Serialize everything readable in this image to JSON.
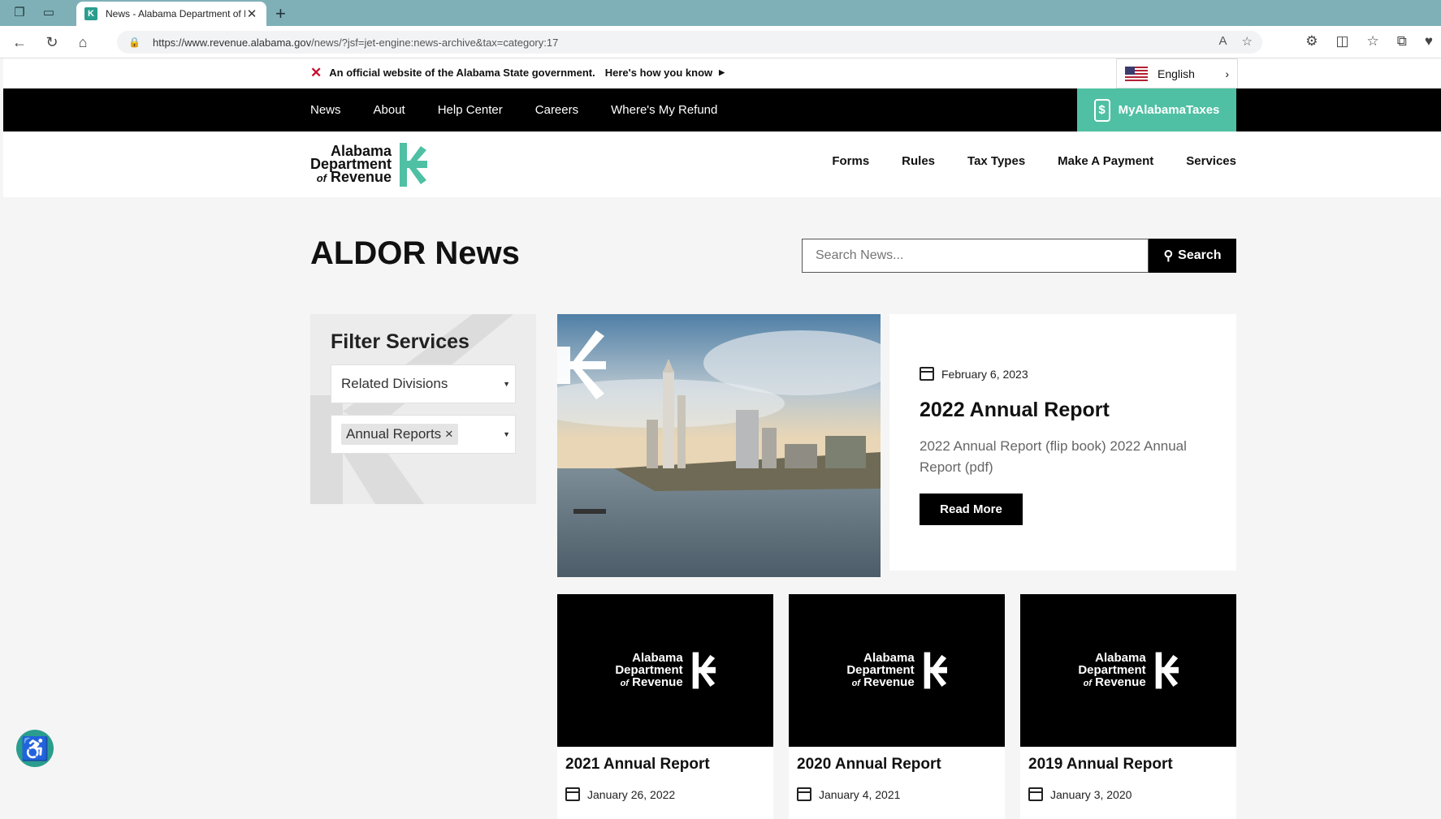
{
  "browser": {
    "tab_title": "News - Alabama Department of Revenue",
    "tab_favicon": "K",
    "url_host": "https://www.revenue.alabama.gov",
    "url_path": "/news/?jsf=jet-engine:news-archive&tax=category:17"
  },
  "gov_banner": {
    "official_text": "An official website of the Alabama State government.",
    "know_link": "Here's how you know",
    "language": "English"
  },
  "top_nav": {
    "items": [
      "News",
      "About",
      "Help Center",
      "Careers",
      "Where's My Refund"
    ],
    "my_alabama_taxes": "MyAlabamaTaxes",
    "my_alabama_taxes_icon": "$"
  },
  "logo": {
    "line1": "Alabama",
    "line2": "Department",
    "line3_of": "of",
    "line3_rest": "Revenue",
    "brand_color": "#4fc0a3"
  },
  "main_nav": {
    "items": [
      "Forms",
      "Rules",
      "Tax Types",
      "Make A Payment",
      "Services"
    ]
  },
  "page": {
    "heading": "ALDOR News",
    "search_placeholder": "Search News...",
    "search_button": "Search"
  },
  "filter": {
    "title": "Filter Services",
    "divisions_placeholder": "Related Divisions",
    "selected_category": "Annual Reports",
    "chip_remove": "×"
  },
  "featured": {
    "date": "February 6, 2023",
    "title": "2022 Annual Report",
    "excerpt": "2022 Annual Report (flip book) 2022 Annual Report (pdf)",
    "button": "Read More"
  },
  "cards": [
    {
      "title": "2021 Annual Report",
      "date": "January 26, 2022"
    },
    {
      "title": "2020 Annual Report",
      "date": "January 4, 2021"
    },
    {
      "title": "2019 Annual Report",
      "date": "January 3, 2020"
    }
  ]
}
